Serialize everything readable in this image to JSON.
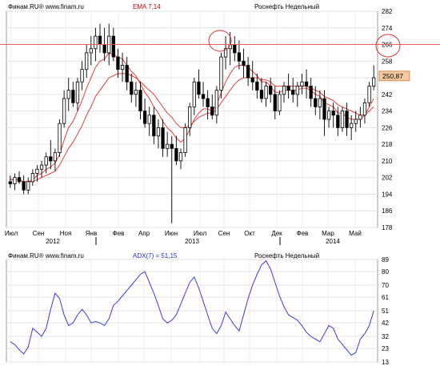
{
  "chart_data": [
    {
      "type": "candlestick",
      "header": {
        "source": "Финам.RU® www.finam.ru",
        "indicator": "EMA 7,14",
        "title": "Роснефть Недельный"
      },
      "y_ticks": [
        178,
        186,
        194,
        202,
        210,
        218,
        226,
        234,
        242,
        250,
        258,
        266,
        274,
        282
      ],
      "ylim": [
        178,
        282
      ],
      "x_labels": [
        "Июл",
        "Сен",
        "Ноя",
        "Янв",
        "Фев",
        "Апр",
        "Июн",
        "Июл",
        "Сен",
        "Окт",
        "Дек",
        "Фев",
        "Мар",
        "Май"
      ],
      "year_labels": [
        "2012",
        "2013",
        "2014"
      ],
      "last_price": "250,87",
      "horizontal_line": 266,
      "ohlc": [
        [
          200,
          203,
          197,
          199
        ],
        [
          199,
          204,
          196,
          202
        ],
        [
          202,
          205,
          199,
          200
        ],
        [
          200,
          203,
          194,
          196
        ],
        [
          196,
          202,
          194,
          200
        ],
        [
          200,
          206,
          198,
          204
        ],
        [
          204,
          208,
          200,
          206
        ],
        [
          206,
          210,
          202,
          208
        ],
        [
          208,
          214,
          204,
          212
        ],
        [
          212,
          220,
          206,
          210
        ],
        [
          210,
          216,
          205,
          214
        ],
        [
          214,
          230,
          212,
          228
        ],
        [
          228,
          244,
          226,
          240
        ],
        [
          240,
          250,
          234,
          244
        ],
        [
          244,
          248,
          236,
          238
        ],
        [
          238,
          250,
          234,
          248
        ],
        [
          248,
          258,
          244,
          254
        ],
        [
          254,
          266,
          250,
          262
        ],
        [
          262,
          270,
          256,
          264
        ],
        [
          264,
          274,
          258,
          270
        ],
        [
          270,
          276,
          262,
          266
        ],
        [
          266,
          274,
          258,
          262
        ],
        [
          262,
          276,
          256,
          270
        ],
        [
          270,
          274,
          258,
          260
        ],
        [
          260,
          264,
          250,
          254
        ],
        [
          254,
          262,
          248,
          256
        ],
        [
          256,
          260,
          244,
          248
        ],
        [
          248,
          252,
          238,
          242
        ],
        [
          242,
          248,
          236,
          244
        ],
        [
          244,
          248,
          230,
          234
        ],
        [
          234,
          240,
          226,
          228
        ],
        [
          228,
          236,
          222,
          232
        ],
        [
          232,
          236,
          218,
          222
        ],
        [
          222,
          230,
          216,
          226
        ],
        [
          226,
          230,
          212,
          216
        ],
        [
          216,
          224,
          212,
          218
        ],
        [
          218,
          222,
          180,
          216
        ],
        [
          216,
          222,
          208,
          210
        ],
        [
          210,
          216,
          206,
          214
        ],
        [
          214,
          228,
          212,
          226
        ],
        [
          226,
          238,
          222,
          236
        ],
        [
          236,
          250,
          232,
          248
        ],
        [
          248,
          254,
          240,
          242
        ],
        [
          242,
          248,
          236,
          240
        ],
        [
          240,
          244,
          230,
          236
        ],
        [
          236,
          242,
          230,
          232
        ],
        [
          232,
          246,
          228,
          244
        ],
        [
          244,
          262,
          240,
          260
        ],
        [
          260,
          270,
          254,
          264
        ],
        [
          264,
          272,
          256,
          266
        ],
        [
          266,
          270,
          258,
          262
        ],
        [
          262,
          268,
          254,
          258
        ],
        [
          258,
          264,
          250,
          256
        ],
        [
          256,
          260,
          246,
          250
        ],
        [
          250,
          258,
          244,
          248
        ],
        [
          248,
          252,
          240,
          244
        ],
        [
          244,
          250,
          238,
          240
        ],
        [
          240,
          248,
          236,
          246
        ],
        [
          246,
          250,
          238,
          242
        ],
        [
          242,
          246,
          230,
          234
        ],
        [
          234,
          244,
          232,
          242
        ],
        [
          242,
          248,
          238,
          246
        ],
        [
          246,
          252,
          240,
          244
        ],
        [
          244,
          250,
          238,
          242
        ],
        [
          242,
          248,
          236,
          246
        ],
        [
          246,
          252,
          242,
          248
        ],
        [
          248,
          254,
          240,
          246
        ],
        [
          246,
          250,
          236,
          240
        ],
        [
          240,
          246,
          232,
          236
        ],
        [
          236,
          244,
          230,
          240
        ],
        [
          240,
          244,
          222,
          230
        ],
        [
          230,
          236,
          226,
          234
        ],
        [
          234,
          238,
          226,
          232
        ],
        [
          232,
          236,
          222,
          226
        ],
        [
          226,
          236,
          224,
          234
        ],
        [
          234,
          238,
          222,
          226
        ],
        [
          226,
          232,
          220,
          228
        ],
        [
          228,
          234,
          224,
          230
        ],
        [
          230,
          236,
          226,
          232
        ],
        [
          232,
          240,
          228,
          238
        ],
        [
          238,
          248,
          236,
          246
        ],
        [
          246,
          256,
          244,
          250
        ]
      ],
      "ema_fast": [
        201,
        201,
        201,
        200,
        200,
        201,
        203,
        204,
        206,
        207,
        209,
        213,
        220,
        226,
        229,
        234,
        239,
        245,
        250,
        255,
        258,
        259,
        262,
        261,
        260,
        259,
        256,
        253,
        251,
        247,
        243,
        240,
        236,
        233,
        229,
        226,
        224,
        221,
        219,
        221,
        225,
        230,
        233,
        235,
        235,
        234,
        237,
        243,
        248,
        252,
        255,
        256,
        256,
        255,
        253,
        251,
        248,
        248,
        246,
        243,
        243,
        244,
        244,
        244,
        244,
        245,
        245,
        244,
        242,
        241,
        238,
        237,
        236,
        233,
        233,
        231,
        230,
        230,
        230,
        232,
        236,
        240
      ],
      "ema_slow": [
        201,
        201,
        201,
        200,
        200,
        200,
        201,
        202,
        203,
        204,
        205,
        208,
        212,
        216,
        219,
        223,
        227,
        232,
        236,
        241,
        244,
        247,
        250,
        251,
        252,
        252,
        252,
        251,
        250,
        248,
        246,
        244,
        242,
        239,
        236,
        233,
        231,
        228,
        226,
        226,
        227,
        229,
        231,
        232,
        233,
        233,
        235,
        238,
        241,
        244,
        247,
        249,
        250,
        250,
        250,
        250,
        249,
        249,
        248,
        246,
        246,
        246,
        246,
        246,
        246,
        246,
        246,
        245,
        244,
        243,
        241,
        240,
        239,
        237,
        236,
        235,
        234,
        233,
        232,
        232,
        234,
        236
      ]
    },
    {
      "type": "line",
      "header": {
        "source": "Финам.RU® www.finam.ru",
        "indicator": "ADX(7) = 51,15",
        "title": "Роснефть Недельный"
      },
      "y_ticks": [
        13,
        23,
        32,
        42,
        51,
        61,
        70,
        80,
        89
      ],
      "ylim": [
        13,
        89
      ],
      "series": [
        {
          "values": [
            28,
            26,
            22,
            19,
            24,
            38,
            35,
            32,
            38,
            52,
            64,
            60,
            48,
            40,
            42,
            48,
            52,
            48,
            42,
            43,
            42,
            40,
            45,
            55,
            58,
            62,
            66,
            70,
            74,
            78,
            80,
            72,
            64,
            55,
            45,
            42,
            44,
            48,
            56,
            64,
            72,
            76,
            68,
            58,
            48,
            38,
            34,
            40,
            50,
            45,
            40,
            36,
            48,
            60,
            70,
            78,
            85,
            88,
            82,
            72,
            62,
            54,
            48,
            46,
            44,
            40,
            35,
            32,
            30,
            28,
            34,
            40,
            38,
            30,
            26,
            22,
            18,
            20,
            30,
            34,
            40,
            51
          ]
        }
      ]
    }
  ]
}
